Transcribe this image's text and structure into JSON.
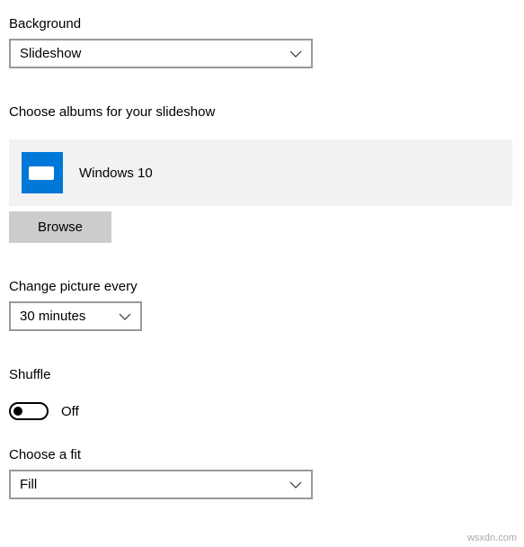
{
  "background": {
    "label": "Background",
    "value": "Slideshow"
  },
  "albums": {
    "label": "Choose albums for your slideshow",
    "item_name": "Windows 10",
    "browse_label": "Browse"
  },
  "change_every": {
    "label": "Change picture every",
    "value": "30 minutes"
  },
  "shuffle": {
    "label": "Shuffle",
    "state_label": "Off"
  },
  "fit": {
    "label": "Choose a fit",
    "value": "Fill"
  },
  "watermark": "wsxdn.com"
}
